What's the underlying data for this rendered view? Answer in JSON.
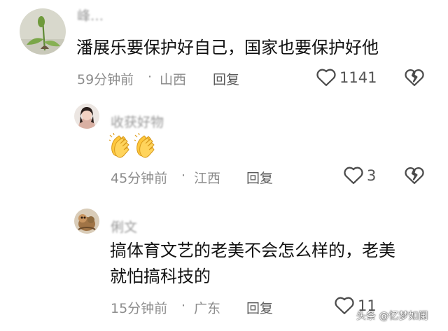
{
  "comments": [
    {
      "username": "峰…",
      "text": "潘展乐要保护好自己，国家也要保护好他",
      "time": "59分钟前",
      "separator": "·",
      "location": "山西",
      "reply_label": "回复",
      "likes": "1141",
      "avatar": "plant-sprout-avatar"
    },
    {
      "username": "收获好物",
      "emoji": "👏👏",
      "time": "45分钟前",
      "separator": "·",
      "location": "江西",
      "reply_label": "回复",
      "likes": "3",
      "avatar": "girl-photo-avatar"
    },
    {
      "username": "俐文",
      "text_line1": "搞体育文艺的老美不会怎么样的，老美",
      "text_line2": "就怕搞科技的",
      "time": "15分钟前",
      "separator": "·",
      "location": "广东",
      "reply_label": "回复",
      "likes": "11",
      "avatar": "cartoon-avatar"
    }
  ],
  "watermark": "头条 @忆梦如阑",
  "icons": {
    "like": "heart-outline-icon",
    "dislike": "broken-heart-icon",
    "clap": "clapping-hands-emoji"
  },
  "colors": {
    "text_primary": "#111111",
    "text_meta": "#8c8c8c",
    "icon_stroke": "#4a4a4a"
  }
}
